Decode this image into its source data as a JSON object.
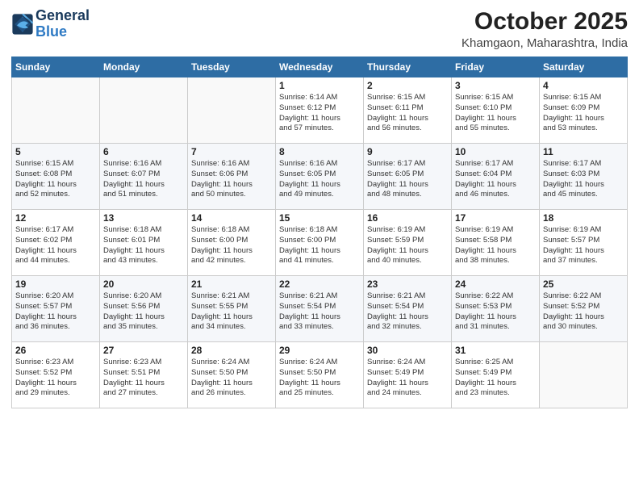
{
  "header": {
    "logo_general": "General",
    "logo_blue": "Blue",
    "month": "October 2025",
    "location": "Khamgaon, Maharashtra, India"
  },
  "weekdays": [
    "Sunday",
    "Monday",
    "Tuesday",
    "Wednesday",
    "Thursday",
    "Friday",
    "Saturday"
  ],
  "weeks": [
    [
      {
        "day": "",
        "info": ""
      },
      {
        "day": "",
        "info": ""
      },
      {
        "day": "",
        "info": ""
      },
      {
        "day": "1",
        "info": "Sunrise: 6:14 AM\nSunset: 6:12 PM\nDaylight: 11 hours\nand 57 minutes."
      },
      {
        "day": "2",
        "info": "Sunrise: 6:15 AM\nSunset: 6:11 PM\nDaylight: 11 hours\nand 56 minutes."
      },
      {
        "day": "3",
        "info": "Sunrise: 6:15 AM\nSunset: 6:10 PM\nDaylight: 11 hours\nand 55 minutes."
      },
      {
        "day": "4",
        "info": "Sunrise: 6:15 AM\nSunset: 6:09 PM\nDaylight: 11 hours\nand 53 minutes."
      }
    ],
    [
      {
        "day": "5",
        "info": "Sunrise: 6:15 AM\nSunset: 6:08 PM\nDaylight: 11 hours\nand 52 minutes."
      },
      {
        "day": "6",
        "info": "Sunrise: 6:16 AM\nSunset: 6:07 PM\nDaylight: 11 hours\nand 51 minutes."
      },
      {
        "day": "7",
        "info": "Sunrise: 6:16 AM\nSunset: 6:06 PM\nDaylight: 11 hours\nand 50 minutes."
      },
      {
        "day": "8",
        "info": "Sunrise: 6:16 AM\nSunset: 6:05 PM\nDaylight: 11 hours\nand 49 minutes."
      },
      {
        "day": "9",
        "info": "Sunrise: 6:17 AM\nSunset: 6:05 PM\nDaylight: 11 hours\nand 48 minutes."
      },
      {
        "day": "10",
        "info": "Sunrise: 6:17 AM\nSunset: 6:04 PM\nDaylight: 11 hours\nand 46 minutes."
      },
      {
        "day": "11",
        "info": "Sunrise: 6:17 AM\nSunset: 6:03 PM\nDaylight: 11 hours\nand 45 minutes."
      }
    ],
    [
      {
        "day": "12",
        "info": "Sunrise: 6:17 AM\nSunset: 6:02 PM\nDaylight: 11 hours\nand 44 minutes."
      },
      {
        "day": "13",
        "info": "Sunrise: 6:18 AM\nSunset: 6:01 PM\nDaylight: 11 hours\nand 43 minutes."
      },
      {
        "day": "14",
        "info": "Sunrise: 6:18 AM\nSunset: 6:00 PM\nDaylight: 11 hours\nand 42 minutes."
      },
      {
        "day": "15",
        "info": "Sunrise: 6:18 AM\nSunset: 6:00 PM\nDaylight: 11 hours\nand 41 minutes."
      },
      {
        "day": "16",
        "info": "Sunrise: 6:19 AM\nSunset: 5:59 PM\nDaylight: 11 hours\nand 40 minutes."
      },
      {
        "day": "17",
        "info": "Sunrise: 6:19 AM\nSunset: 5:58 PM\nDaylight: 11 hours\nand 38 minutes."
      },
      {
        "day": "18",
        "info": "Sunrise: 6:19 AM\nSunset: 5:57 PM\nDaylight: 11 hours\nand 37 minutes."
      }
    ],
    [
      {
        "day": "19",
        "info": "Sunrise: 6:20 AM\nSunset: 5:57 PM\nDaylight: 11 hours\nand 36 minutes."
      },
      {
        "day": "20",
        "info": "Sunrise: 6:20 AM\nSunset: 5:56 PM\nDaylight: 11 hours\nand 35 minutes."
      },
      {
        "day": "21",
        "info": "Sunrise: 6:21 AM\nSunset: 5:55 PM\nDaylight: 11 hours\nand 34 minutes."
      },
      {
        "day": "22",
        "info": "Sunrise: 6:21 AM\nSunset: 5:54 PM\nDaylight: 11 hours\nand 33 minutes."
      },
      {
        "day": "23",
        "info": "Sunrise: 6:21 AM\nSunset: 5:54 PM\nDaylight: 11 hours\nand 32 minutes."
      },
      {
        "day": "24",
        "info": "Sunrise: 6:22 AM\nSunset: 5:53 PM\nDaylight: 11 hours\nand 31 minutes."
      },
      {
        "day": "25",
        "info": "Sunrise: 6:22 AM\nSunset: 5:52 PM\nDaylight: 11 hours\nand 30 minutes."
      }
    ],
    [
      {
        "day": "26",
        "info": "Sunrise: 6:23 AM\nSunset: 5:52 PM\nDaylight: 11 hours\nand 29 minutes."
      },
      {
        "day": "27",
        "info": "Sunrise: 6:23 AM\nSunset: 5:51 PM\nDaylight: 11 hours\nand 27 minutes."
      },
      {
        "day": "28",
        "info": "Sunrise: 6:24 AM\nSunset: 5:50 PM\nDaylight: 11 hours\nand 26 minutes."
      },
      {
        "day": "29",
        "info": "Sunrise: 6:24 AM\nSunset: 5:50 PM\nDaylight: 11 hours\nand 25 minutes."
      },
      {
        "day": "30",
        "info": "Sunrise: 6:24 AM\nSunset: 5:49 PM\nDaylight: 11 hours\nand 24 minutes."
      },
      {
        "day": "31",
        "info": "Sunrise: 6:25 AM\nSunset: 5:49 PM\nDaylight: 11 hours\nand 23 minutes."
      },
      {
        "day": "",
        "info": ""
      }
    ]
  ]
}
